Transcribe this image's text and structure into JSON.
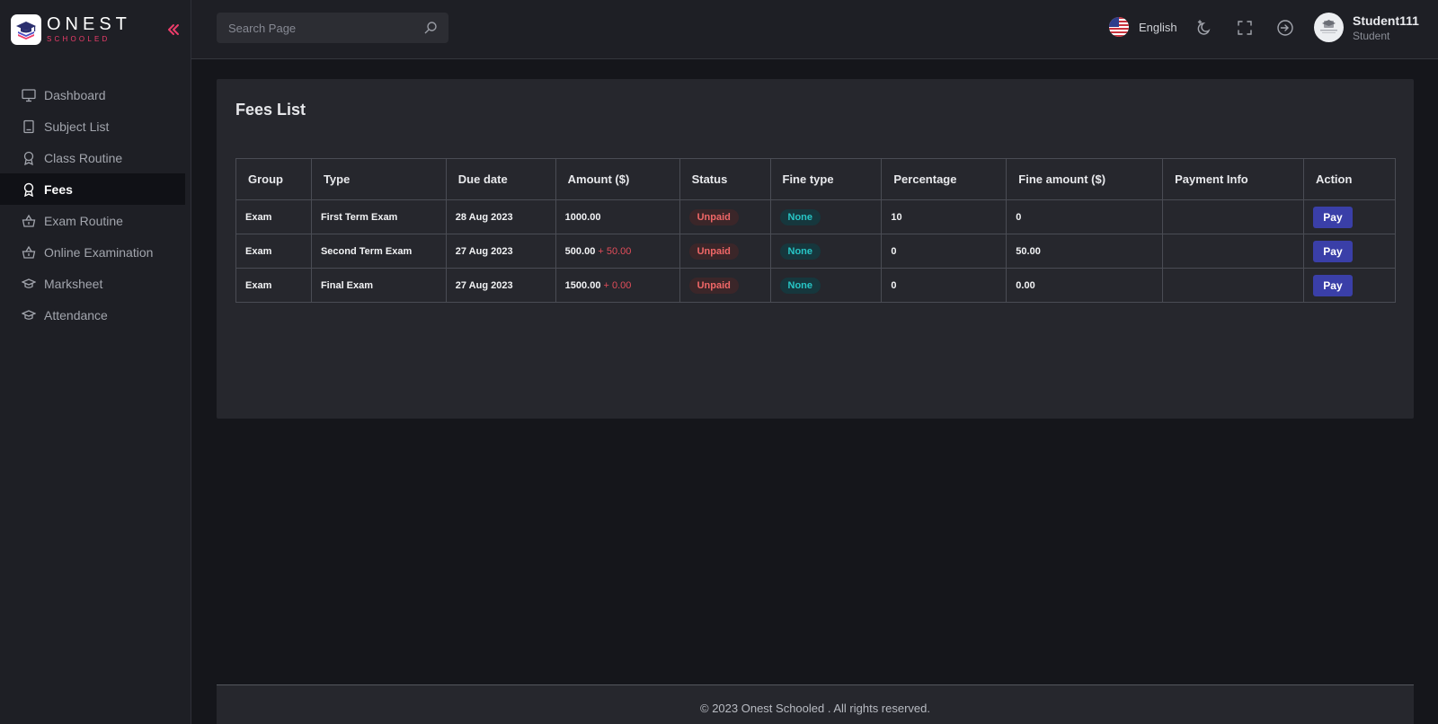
{
  "brand": {
    "name": "ONEST",
    "tagline": "SCHOOLED"
  },
  "sidebar": {
    "items": [
      {
        "label": "Dashboard",
        "icon": "monitor-icon"
      },
      {
        "label": "Subject List",
        "icon": "book-icon"
      },
      {
        "label": "Class Routine",
        "icon": "award-icon"
      },
      {
        "label": "Fees",
        "icon": "award-icon",
        "active": true
      },
      {
        "label": "Exam Routine",
        "icon": "basket-icon"
      },
      {
        "label": "Online Examination",
        "icon": "basket-icon"
      },
      {
        "label": "Marksheet",
        "icon": "graduation-cap-icon"
      },
      {
        "label": "Attendance",
        "icon": "graduation-cap-icon"
      }
    ]
  },
  "header": {
    "search_placeholder": "Search Page",
    "language": "English",
    "user": {
      "name": "Student111",
      "role": "Student"
    }
  },
  "main": {
    "title": "Fees List",
    "table": {
      "columns": [
        "Group",
        "Type",
        "Due date",
        "Amount ($)",
        "Status",
        "Fine type",
        "Percentage",
        "Fine amount ($)",
        "Payment Info",
        "Action"
      ],
      "rows": [
        {
          "group": "Exam",
          "type": "First Term Exam",
          "due": "28 Aug 2023",
          "amount": "1000.00",
          "fine": "",
          "status": "Unpaid",
          "fine_type": "None",
          "percentage": "10",
          "fine_amount": "0",
          "payment_info": "",
          "action": "Pay"
        },
        {
          "group": "Exam",
          "type": "Second Term Exam",
          "due": "27 Aug 2023",
          "amount": "500.00",
          "fine": "+ 50.00",
          "status": "Unpaid",
          "fine_type": "None",
          "percentage": "0",
          "fine_amount": "50.00",
          "payment_info": "",
          "action": "Pay"
        },
        {
          "group": "Exam",
          "type": "Final Exam",
          "due": "27 Aug 2023",
          "amount": "1500.00",
          "fine": "+ 0.00",
          "status": "Unpaid",
          "fine_type": "None",
          "percentage": "0",
          "fine_amount": "0.00",
          "payment_info": "",
          "action": "Pay"
        }
      ]
    }
  },
  "footer": {
    "text": "© 2023 Onest Schooled . All rights reserved."
  },
  "colors": {
    "accent": "#ee3d6b",
    "primary_button": "#3a3fa8",
    "unpaid": "#f06767",
    "none_badge": "#27c6c6"
  }
}
